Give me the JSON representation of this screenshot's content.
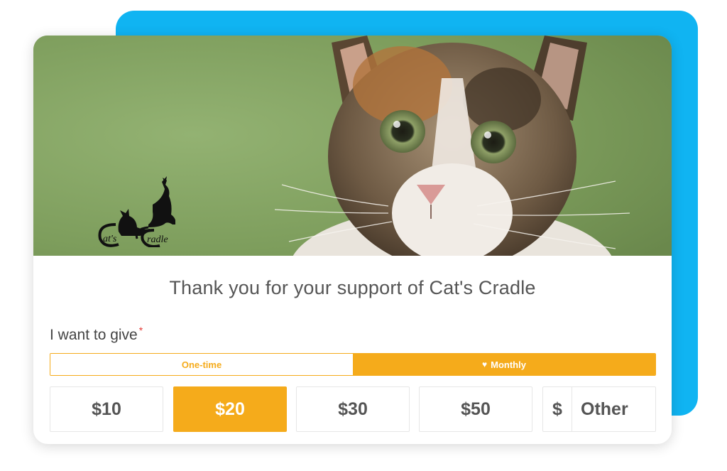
{
  "backdrop_color": "#10b4f2",
  "accent_color": "#f5ab1b",
  "hero": {
    "image": "calico-cat-photo",
    "logo": {
      "icon": "two-cats-silhouette-icon",
      "text_part1": "at's",
      "text_part2": "radle"
    }
  },
  "title": "Thank you for your support of Cat's Cradle",
  "give": {
    "label": "I want to give",
    "required_mark": "*"
  },
  "frequency": {
    "options": [
      {
        "label": "One-time",
        "selected": false
      },
      {
        "label": "Monthly",
        "selected": true,
        "icon": "heart-icon"
      }
    ]
  },
  "amounts": [
    {
      "label": "$10",
      "selected": false
    },
    {
      "label": "$20",
      "selected": true
    },
    {
      "label": "$30",
      "selected": false
    },
    {
      "label": "$50",
      "selected": false
    }
  ],
  "other": {
    "currency_symbol": "$",
    "placeholder": "Other"
  }
}
